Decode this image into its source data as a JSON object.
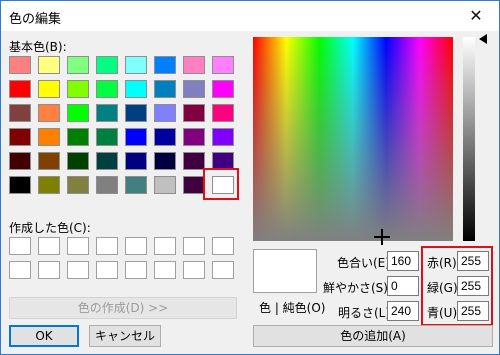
{
  "window": {
    "title": "色の編集",
    "close_glyph": "✕"
  },
  "basic_colors": {
    "label": "基本色(B):",
    "swatches": [
      "#ff8080",
      "#ffff80",
      "#80ff80",
      "#00ff80",
      "#80ffff",
      "#0080ff",
      "#ff80c0",
      "#ff80ff",
      "#ff0000",
      "#ffff00",
      "#80ff00",
      "#00ff40",
      "#00ffff",
      "#0080c0",
      "#8080c0",
      "#ff00ff",
      "#804040",
      "#ff8040",
      "#00ff00",
      "#008080",
      "#004080",
      "#8080ff",
      "#800040",
      "#ff0080",
      "#800000",
      "#ff8000",
      "#008000",
      "#008040",
      "#0000ff",
      "#0000a0",
      "#800080",
      "#8000ff",
      "#400000",
      "#804000",
      "#004000",
      "#004040",
      "#000080",
      "#000040",
      "#400040",
      "#400080",
      "#000000",
      "#808000",
      "#808040",
      "#808080",
      "#408080",
      "#c0c0c0",
      "#400040",
      "#ffffff"
    ],
    "selected_color": "#ffffff"
  },
  "custom_colors": {
    "label": "作成した色(C):",
    "count": 16,
    "color": "#ffffff"
  },
  "buttons": {
    "define_custom": "色の作成(D) >>",
    "ok": "OK",
    "cancel": "キャンセル",
    "add_to_custom": "色の追加(A)"
  },
  "preview_label": "色 | 純色(O)",
  "hsl": {
    "hue_label": "色合い(E):",
    "hue": "160",
    "sat_label": "鮮やかさ(S):",
    "sat": "0",
    "lum_label": "明るさ(L):",
    "lum": "240"
  },
  "rgb": {
    "red_label": "赤(R):",
    "red": "255",
    "green_label": "緑(G):",
    "green": "255",
    "blue_label": "青(U):",
    "blue": "255"
  },
  "highlight_color": "#e0101a"
}
